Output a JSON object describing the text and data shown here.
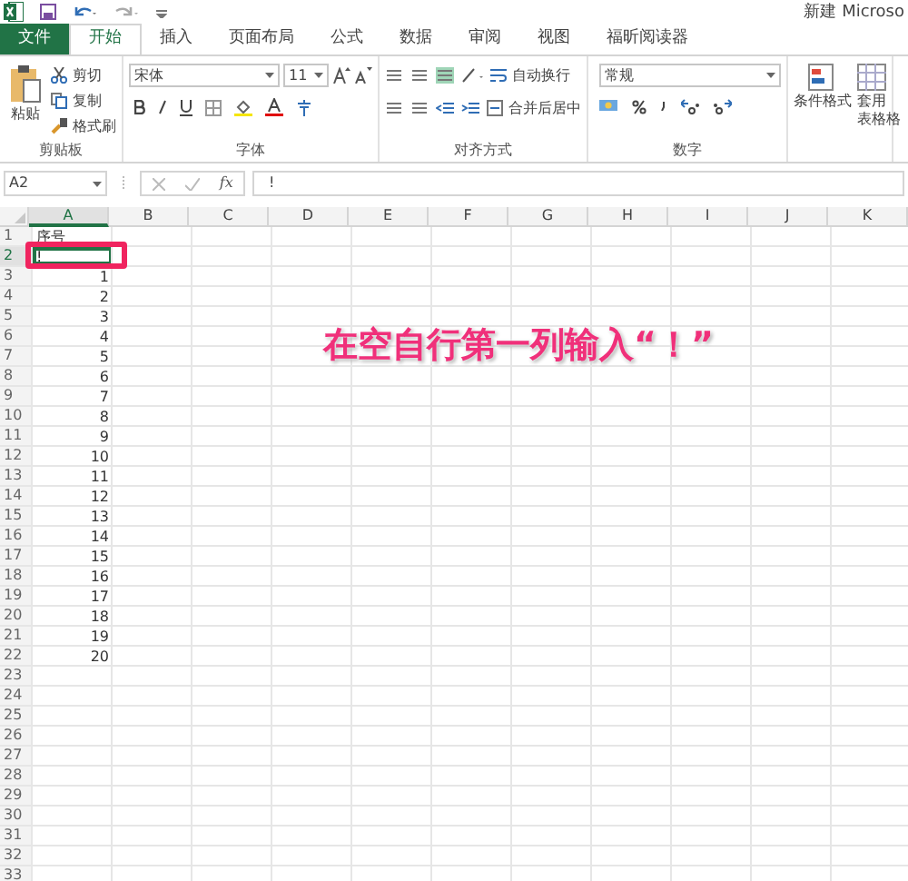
{
  "window": {
    "title": "新建 Microso"
  },
  "tabs": [
    {
      "label": "文件",
      "kind": "file",
      "selected": false
    },
    {
      "label": "开始",
      "kind": "tab",
      "selected": true
    },
    {
      "label": "插入",
      "kind": "tab",
      "selected": false
    },
    {
      "label": "页面布局",
      "kind": "tab",
      "selected": false
    },
    {
      "label": "公式",
      "kind": "tab",
      "selected": false
    },
    {
      "label": "数据",
      "kind": "tab",
      "selected": false
    },
    {
      "label": "审阅",
      "kind": "tab",
      "selected": false
    },
    {
      "label": "视图",
      "kind": "tab",
      "selected": false
    },
    {
      "label": "福昕阅读器",
      "kind": "tab",
      "selected": false
    }
  ],
  "ribbon": {
    "clipboard": {
      "paste": "粘贴",
      "cut": "剪切",
      "copy": "复制",
      "format_painter": "格式刷",
      "label": "剪贴板"
    },
    "font": {
      "font_name": "宋体",
      "font_size": "11",
      "label": "字体"
    },
    "alignment": {
      "wrap_text": "自动换行",
      "merge_center": "合并后居中",
      "label": "对齐方式"
    },
    "number": {
      "format": "常规",
      "label": "数字"
    },
    "styles": {
      "conditional_formatting": "条件格式",
      "format_as_table": [
        "套用",
        "表格格"
      ]
    }
  },
  "formula_bar": {
    "name_box": "A2",
    "function_label": "fx",
    "value": "!"
  },
  "sheet": {
    "columns": [
      {
        "label": "A",
        "selected": true
      },
      {
        "label": "B",
        "selected": false
      },
      {
        "label": "C",
        "selected": false
      },
      {
        "label": "D",
        "selected": false
      },
      {
        "label": "E",
        "selected": false
      },
      {
        "label": "F",
        "selected": false
      },
      {
        "label": "G",
        "selected": false
      },
      {
        "label": "H",
        "selected": false
      },
      {
        "label": "I",
        "selected": false
      },
      {
        "label": "J",
        "selected": false
      },
      {
        "label": "K",
        "selected": false
      }
    ],
    "rows": [
      {
        "header": "1",
        "selected": false,
        "cells": [
          "序号"
        ]
      },
      {
        "header": "2",
        "selected": true,
        "cells": [
          "!"
        ]
      },
      {
        "header": "3",
        "selected": false,
        "cells": [
          "1"
        ]
      },
      {
        "header": "4",
        "selected": false,
        "cells": [
          "2"
        ]
      },
      {
        "header": "5",
        "selected": false,
        "cells": [
          "3"
        ]
      },
      {
        "header": "6",
        "selected": false,
        "cells": [
          "4"
        ]
      },
      {
        "header": "7",
        "selected": false,
        "cells": [
          "5"
        ]
      },
      {
        "header": "8",
        "selected": false,
        "cells": [
          "6"
        ]
      },
      {
        "header": "9",
        "selected": false,
        "cells": [
          "7"
        ]
      },
      {
        "header": "10",
        "selected": false,
        "cells": [
          "8"
        ]
      },
      {
        "header": "11",
        "selected": false,
        "cells": [
          "9"
        ]
      },
      {
        "header": "12",
        "selected": false,
        "cells": [
          "10"
        ]
      },
      {
        "header": "13",
        "selected": false,
        "cells": [
          "11"
        ]
      },
      {
        "header": "14",
        "selected": false,
        "cells": [
          "12"
        ]
      },
      {
        "header": "15",
        "selected": false,
        "cells": [
          "13"
        ]
      },
      {
        "header": "16",
        "selected": false,
        "cells": [
          "14"
        ]
      },
      {
        "header": "17",
        "selected": false,
        "cells": [
          "15"
        ]
      },
      {
        "header": "18",
        "selected": false,
        "cells": [
          "16"
        ]
      },
      {
        "header": "19",
        "selected": false,
        "cells": [
          "17"
        ]
      },
      {
        "header": "20",
        "selected": false,
        "cells": [
          "18"
        ]
      },
      {
        "header": "21",
        "selected": false,
        "cells": [
          "19"
        ]
      },
      {
        "header": "22",
        "selected": false,
        "cells": [
          "20"
        ]
      },
      {
        "header": "23",
        "selected": false,
        "cells": []
      },
      {
        "header": "24",
        "selected": false,
        "cells": []
      },
      {
        "header": "25",
        "selected": false,
        "cells": []
      },
      {
        "header": "26",
        "selected": false,
        "cells": []
      },
      {
        "header": "27",
        "selected": false,
        "cells": []
      },
      {
        "header": "28",
        "selected": false,
        "cells": []
      },
      {
        "header": "29",
        "selected": false,
        "cells": []
      },
      {
        "header": "30",
        "selected": false,
        "cells": []
      },
      {
        "header": "31",
        "selected": false,
        "cells": []
      },
      {
        "header": "32",
        "selected": false,
        "cells": []
      },
      {
        "header": "33",
        "selected": false,
        "cells": []
      }
    ]
  },
  "annotation": {
    "text": "在空自行第一列输入“！”"
  }
}
